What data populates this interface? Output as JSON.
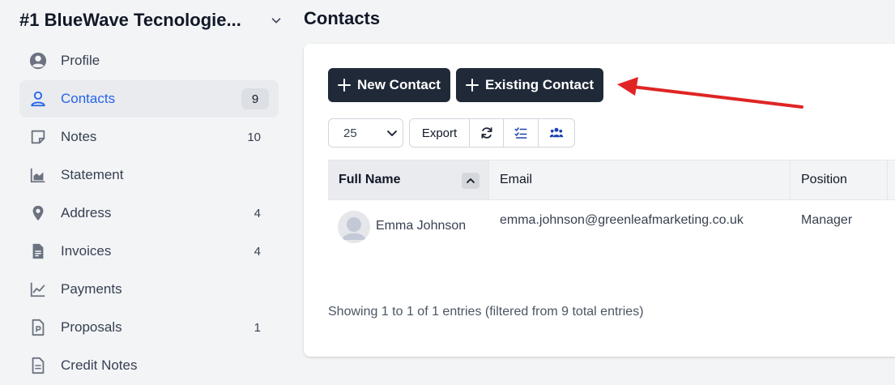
{
  "company": {
    "name": "#1 BlueWave Tecnologie..."
  },
  "page": {
    "title": "Contacts"
  },
  "sidebar": {
    "items": [
      {
        "label": "Profile",
        "count": ""
      },
      {
        "label": "Contacts",
        "count": "9"
      },
      {
        "label": "Notes",
        "count": "10"
      },
      {
        "label": "Statement",
        "count": ""
      },
      {
        "label": "Address",
        "count": "4"
      },
      {
        "label": "Invoices",
        "count": "4"
      },
      {
        "label": "Payments",
        "count": ""
      },
      {
        "label": "Proposals",
        "count": "1"
      },
      {
        "label": "Credit Notes",
        "count": ""
      }
    ]
  },
  "actions": {
    "new_contact": "New Contact",
    "existing_contact": "Existing Contact"
  },
  "toolbar": {
    "per_page": "25",
    "export": "Export"
  },
  "table": {
    "columns": [
      "Full Name",
      "Email",
      "Position"
    ],
    "rows": [
      {
        "name": "Emma Johnson",
        "email": "emma.johnson@greenleafmarketing.co.uk",
        "position": "Manager"
      }
    ]
  },
  "footer": {
    "info": "Showing 1 to 1 of 1 entries (filtered from 9 total entries)"
  },
  "colors": {
    "primary_button": "#1f2937",
    "accent": "#2563eb",
    "annotation_arrow": "#e02424"
  }
}
